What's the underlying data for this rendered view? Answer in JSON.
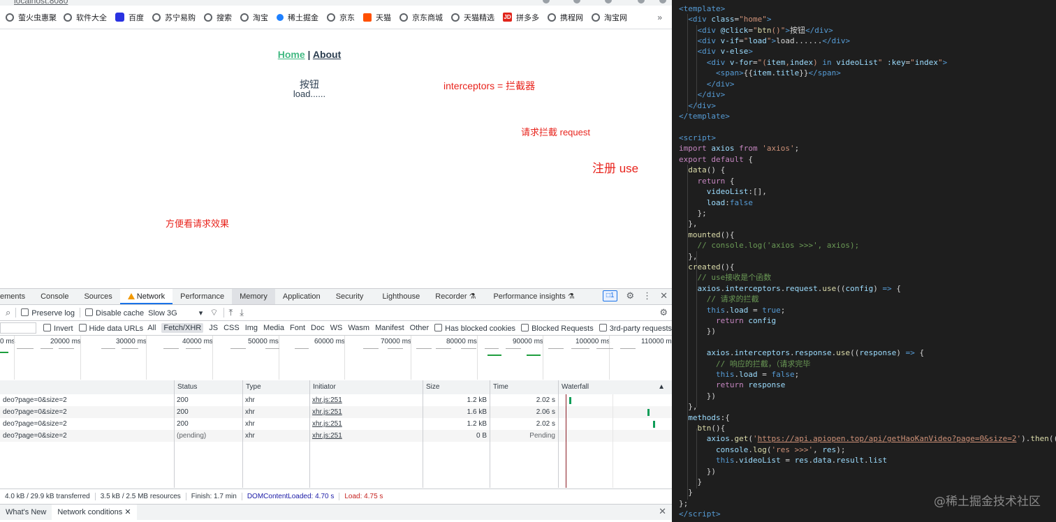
{
  "browser": {
    "url": "localhost:8080",
    "bookmarks": [
      {
        "label": "萤火虫惠聚",
        "icon": "globe-icon"
      },
      {
        "label": "软件大全",
        "icon": "globe-icon"
      },
      {
        "label": "百度",
        "icon": "baidu-paw-icon"
      },
      {
        "label": "苏宁易购",
        "icon": "globe-icon"
      },
      {
        "label": "搜索",
        "icon": "globe-icon"
      },
      {
        "label": "淘宝",
        "icon": "globe-icon"
      },
      {
        "label": "稀土掘金",
        "icon": "juejin-icon"
      },
      {
        "label": "京东",
        "icon": "globe-icon"
      },
      {
        "label": "天猫",
        "icon": "tmall-icon"
      },
      {
        "label": "京东商城",
        "icon": "globe-icon"
      },
      {
        "label": "天猫精选",
        "icon": "globe-icon"
      },
      {
        "label": "拼多多",
        "icon": "jd-icon"
      },
      {
        "label": "携程网",
        "icon": "globe-icon"
      },
      {
        "label": "淘宝网",
        "icon": "globe-icon"
      }
    ],
    "bookmarks_more": "»"
  },
  "app": {
    "nav_home": "Home",
    "nav_sep": " | ",
    "nav_about": "About",
    "button_label": "按钮",
    "loading_text": "load......"
  },
  "notes": {
    "n1": "interceptors = 拦截器",
    "n2": "请求拦截 request",
    "n3": "注册 use",
    "n4": "方便看请求效果"
  },
  "devtools": {
    "tabs": [
      "ements",
      "Console",
      "Sources",
      "Network",
      "Performance",
      "Memory",
      "Application",
      "Security",
      "Lighthouse",
      "Recorder ⚗",
      "Performance insights ⚗"
    ],
    "message_count": "1",
    "toolbar": {
      "preserve_log": "Preserve log",
      "disable_cache": "Disable cache",
      "throttle": "Slow 3G"
    },
    "filter": {
      "invert": "Invert",
      "hide_data_urls": "Hide data URLs",
      "types": [
        "All",
        "Fetch/XHR",
        "JS",
        "CSS",
        "Img",
        "Media",
        "Font",
        "Doc",
        "WS",
        "Wasm",
        "Manifest",
        "Other"
      ],
      "has_blocked_cookies": "Has blocked cookies",
      "blocked_requests": "Blocked Requests",
      "third_party": "3rd-party requests"
    },
    "overview_ticks": [
      "0 ms",
      "20000 ms",
      "30000 ms",
      "40000 ms",
      "50000 ms",
      "60000 ms",
      "70000 ms",
      "80000 ms",
      "90000 ms",
      "100000 ms",
      "110000 m"
    ],
    "columns": [
      "Status",
      "Type",
      "Initiator",
      "Size",
      "Time",
      "Waterfall"
    ],
    "rows": [
      {
        "name": "deo?page=0&size=2",
        "status": "200",
        "type": "xhr",
        "initiator": "xhr.js:251",
        "size": "1.2 kB",
        "time": "2.02 s"
      },
      {
        "name": "deo?page=0&size=2",
        "status": "200",
        "type": "xhr",
        "initiator": "xhr.js:251",
        "size": "1.6 kB",
        "time": "2.06 s"
      },
      {
        "name": "deo?page=0&size=2",
        "status": "200",
        "type": "xhr",
        "initiator": "xhr.js:251",
        "size": "1.2 kB",
        "time": "2.02 s"
      },
      {
        "name": "deo?page=0&size=2",
        "status": "(pending)",
        "type": "xhr",
        "initiator": "xhr.js:251",
        "size": "0 B",
        "time": "Pending"
      }
    ],
    "status_bar": {
      "transferred": "4.0 kB / 29.9 kB transferred",
      "resources": "3.5 kB / 2.5 MB resources",
      "finish": "Finish: 1.7 min",
      "dcl": "DOMContentLoaded: 4.70 s",
      "load": "Load: 4.75 s"
    },
    "drawer_tabs": [
      "What's New",
      "Network conditions"
    ]
  },
  "editor": {
    "watermark": "@稀土掘金技术社区"
  }
}
